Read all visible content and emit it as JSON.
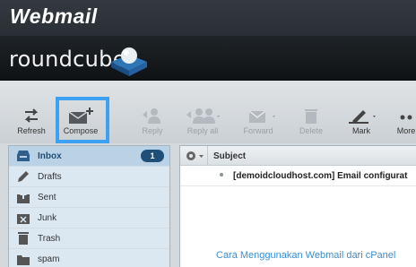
{
  "header": {
    "title": "Webmail"
  },
  "brand": {
    "logo_text": "roundcube"
  },
  "toolbar": {
    "refresh": "Refresh",
    "compose": "Compose",
    "reply": "Reply",
    "reply_all": "Reply all",
    "forward": "Forward",
    "delete": "Delete",
    "mark": "Mark",
    "more": "More"
  },
  "folders": [
    {
      "label": "Inbox",
      "icon": "inbox-icon",
      "count": "1"
    },
    {
      "label": "Drafts",
      "icon": "pencil-icon"
    },
    {
      "label": "Sent",
      "icon": "sent-icon"
    },
    {
      "label": "Junk",
      "icon": "junk-icon"
    },
    {
      "label": "Trash",
      "icon": "trash-icon"
    },
    {
      "label": "spam",
      "icon": "folder-icon"
    }
  ],
  "message_list": {
    "column_subject": "Subject",
    "rows": [
      {
        "subject": "[demoidcloudhost.com] Email configurat"
      }
    ]
  },
  "caption": "Cara Menggunakan Webmail dari cPanel",
  "colors": {
    "highlight": "#3ea0f0",
    "accent": "#1f4f78",
    "caption": "#3a8ed3"
  }
}
